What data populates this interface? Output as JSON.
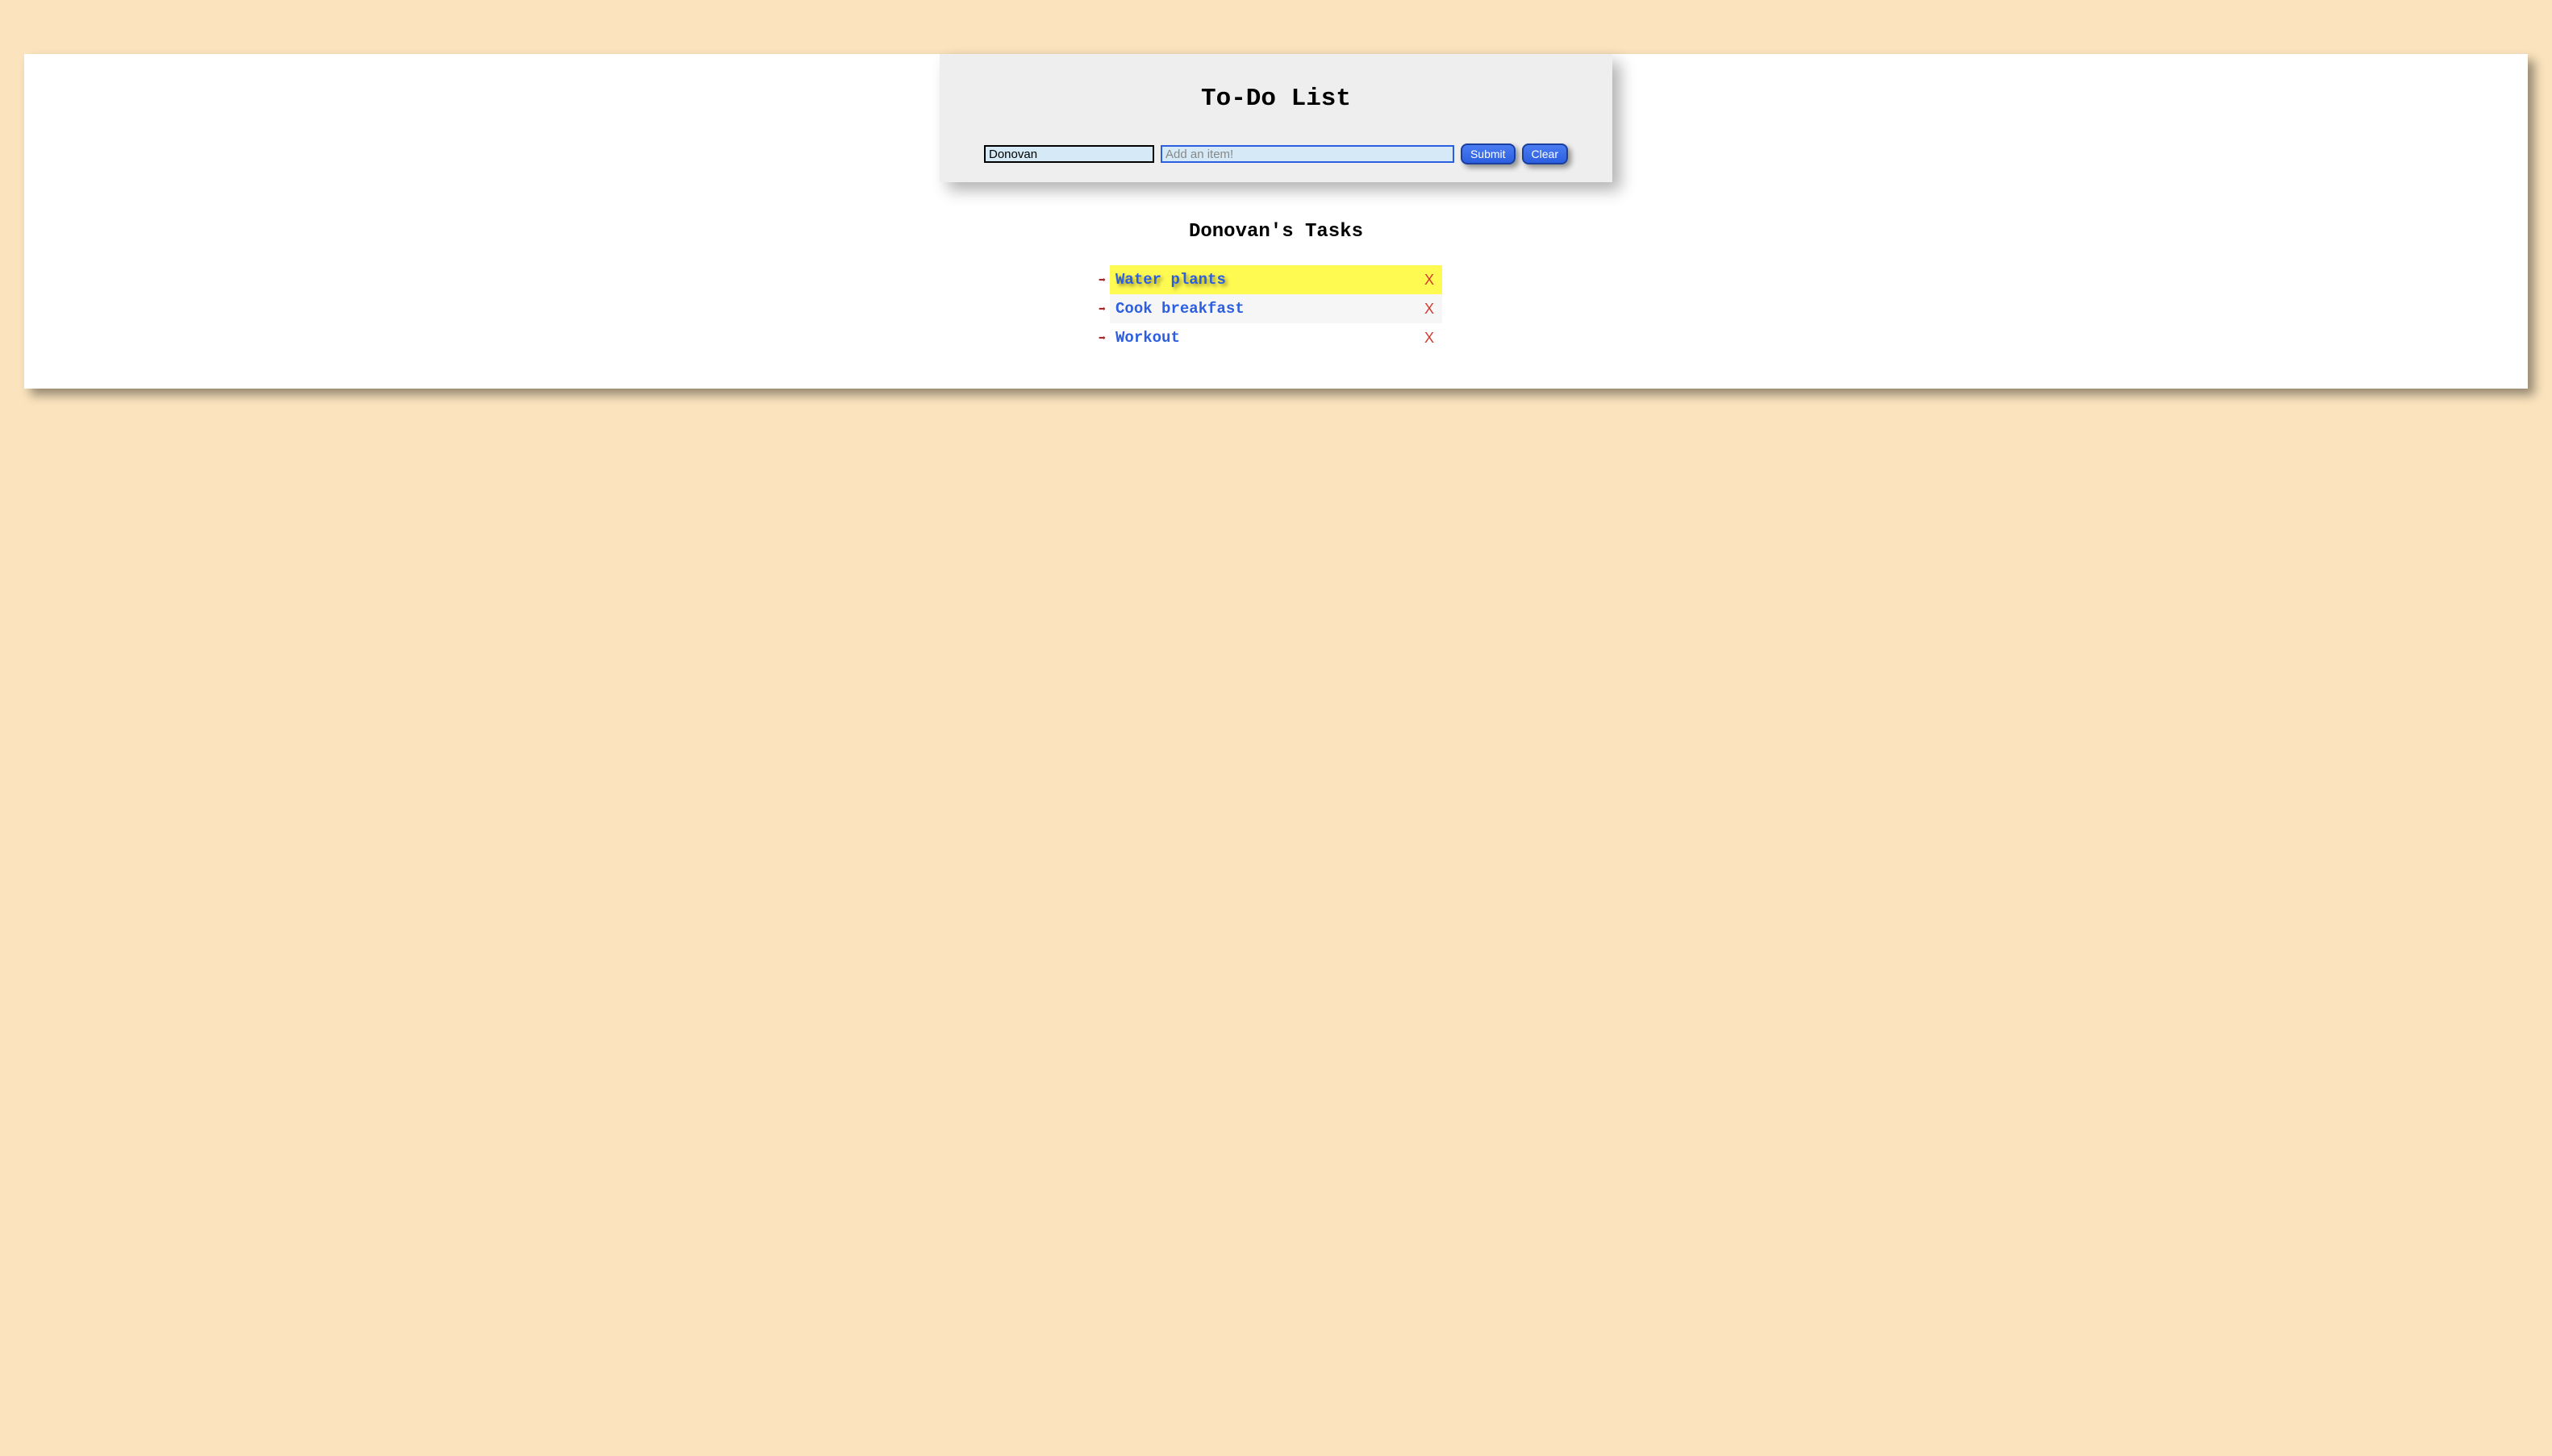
{
  "header": {
    "title": "To-Do List",
    "name_input_value": "Donovan",
    "item_input_placeholder": "Add an item!",
    "submit_label": "Submit",
    "clear_label": "Clear"
  },
  "tasks_heading": "Donovan's Tasks",
  "bullet_char": "➡",
  "delete_char": "X",
  "tasks": [
    {
      "label": "Water plants",
      "highlighted": true
    },
    {
      "label": "Cook breakfast",
      "highlighted": false
    },
    {
      "label": "Workout",
      "highlighted": false
    }
  ]
}
